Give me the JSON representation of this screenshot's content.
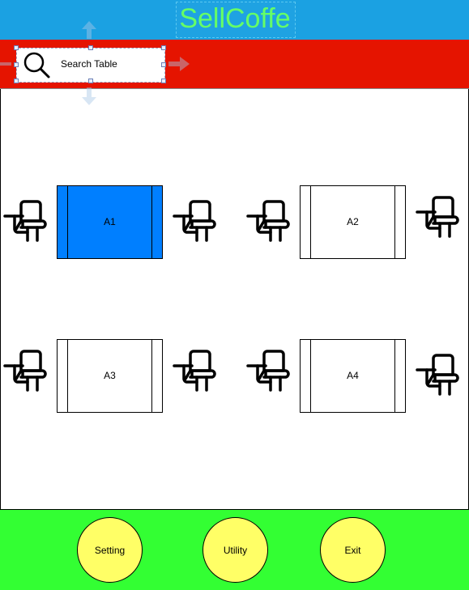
{
  "app": {
    "title": "SellCoffe"
  },
  "search": {
    "placeholder": "Search Table"
  },
  "tables": [
    {
      "label": "A1",
      "selected": true
    },
    {
      "label": "A2",
      "selected": false
    },
    {
      "label": "A3",
      "selected": false
    },
    {
      "label": "A4",
      "selected": false
    }
  ],
  "footer": {
    "buttons": [
      {
        "label": "Setting"
      },
      {
        "label": "Utility"
      },
      {
        "label": "Exit"
      }
    ]
  },
  "colors": {
    "header": "#1ba1e2",
    "title": "#66ff66",
    "search_bar": "#e51400",
    "selected_table": "#007fff",
    "footer": "#33ff33",
    "footer_button": "#ffff66"
  },
  "icons": [
    "search-icon",
    "chair-icon"
  ]
}
